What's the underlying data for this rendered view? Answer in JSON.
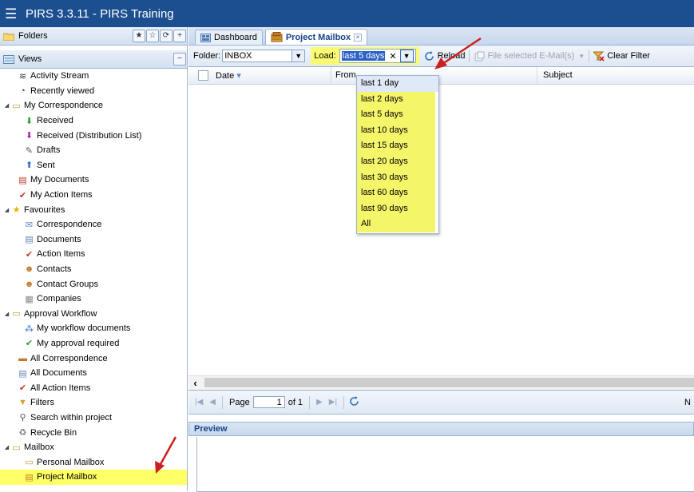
{
  "app": {
    "title": "PIRS 3.3.11  -  PIRS Training",
    "menu_icon": "hamburger-icon"
  },
  "sidebar": {
    "folders_label": "Folders",
    "views_label": "Views",
    "items": [
      {
        "label": "Activity Stream",
        "icon": "activity-stream-icon",
        "indent": 1
      },
      {
        "label": "Recently viewed",
        "icon": "clock-icon",
        "indent": 1
      },
      {
        "label": "My Correspondence",
        "icon": "folder-icon",
        "indent": 0,
        "expander": "▲"
      },
      {
        "label": "Received",
        "icon": "received-icon",
        "indent": 2
      },
      {
        "label": "Received (Distribution List)",
        "icon": "received-distribution-icon",
        "indent": 2
      },
      {
        "label": "Drafts",
        "icon": "drafts-icon",
        "indent": 2
      },
      {
        "label": "Sent",
        "icon": "sent-icon",
        "indent": 2
      },
      {
        "label": "My Documents",
        "icon": "documents-icon",
        "indent": 1
      },
      {
        "label": "My Action Items",
        "icon": "checkmark-icon",
        "indent": 1
      },
      {
        "label": "Favourites",
        "icon": "star-icon",
        "indent": 0,
        "expander": "▲"
      },
      {
        "label": "Correspondence",
        "icon": "mail-icon",
        "indent": 2
      },
      {
        "label": "Documents",
        "icon": "document-icon",
        "indent": 2
      },
      {
        "label": "Action Items",
        "icon": "checkmark-icon",
        "indent": 2
      },
      {
        "label": "Contacts",
        "icon": "contact-icon",
        "indent": 2
      },
      {
        "label": "Contact Groups",
        "icon": "contact-group-icon",
        "indent": 2
      },
      {
        "label": "Companies",
        "icon": "company-icon",
        "indent": 2
      },
      {
        "label": "Approval Workflow",
        "icon": "folder-icon",
        "indent": 0,
        "expander": "▲"
      },
      {
        "label": "My workflow documents",
        "icon": "workflow-icon",
        "indent": 2
      },
      {
        "label": "My approval required",
        "icon": "approval-icon",
        "indent": 2
      },
      {
        "label": "All Correspondence",
        "icon": "all-correspondence-icon",
        "indent": 1
      },
      {
        "label": "All Documents",
        "icon": "all-documents-icon",
        "indent": 1
      },
      {
        "label": "All Action Items",
        "icon": "checkmark-icon",
        "indent": 1
      },
      {
        "label": "Filters",
        "icon": "filter-icon",
        "indent": 1
      },
      {
        "label": "Search within project",
        "icon": "search-icon",
        "indent": 1
      },
      {
        "label": "Recycle Bin",
        "icon": "recycle-bin-icon",
        "indent": 1
      },
      {
        "label": "Mailbox",
        "icon": "folder-icon",
        "indent": 0,
        "expander": "▲"
      },
      {
        "label": "Personal Mailbox",
        "icon": "personal-mailbox-icon",
        "indent": 2
      },
      {
        "label": "Project Mailbox",
        "icon": "project-mailbox-icon",
        "indent": 2,
        "selected": true
      }
    ]
  },
  "tabs": [
    {
      "label": "Dashboard",
      "icon": "dashboard-icon",
      "active": false
    },
    {
      "label": "Project Mailbox",
      "icon": "project-mailbox-icon",
      "active": true,
      "closable": true
    }
  ],
  "toolbar": {
    "folder_label": "Folder:",
    "folder_value": "INBOX",
    "load_label": "Load:",
    "load_value": "last 5 days",
    "clear_symbol": "✕",
    "reload_label": "Reload",
    "file_selected_label": "File selected E-Mail(s)",
    "clear_filter_label": "Clear Filter"
  },
  "grid": {
    "columns": [
      "Date",
      "From",
      "Subject"
    ],
    "sort_indicator": "▾"
  },
  "pager": {
    "page_label": "Page",
    "page_value": "1",
    "of_label": "of 1",
    "right_text": "N"
  },
  "dropdown": {
    "options": [
      "last 1 day",
      "last 2 days",
      "last 5 days",
      "last 10 days",
      "last 15 days",
      "last 20 days",
      "last 30 days",
      "last 60 days",
      "last 90 days",
      "All"
    ],
    "selected_index": 0
  },
  "preview": {
    "title": "Preview"
  },
  "colors": {
    "header": "#1c4f8f",
    "highlight": "#fbfb73",
    "annotation_arrow": "#cc1f1f"
  }
}
